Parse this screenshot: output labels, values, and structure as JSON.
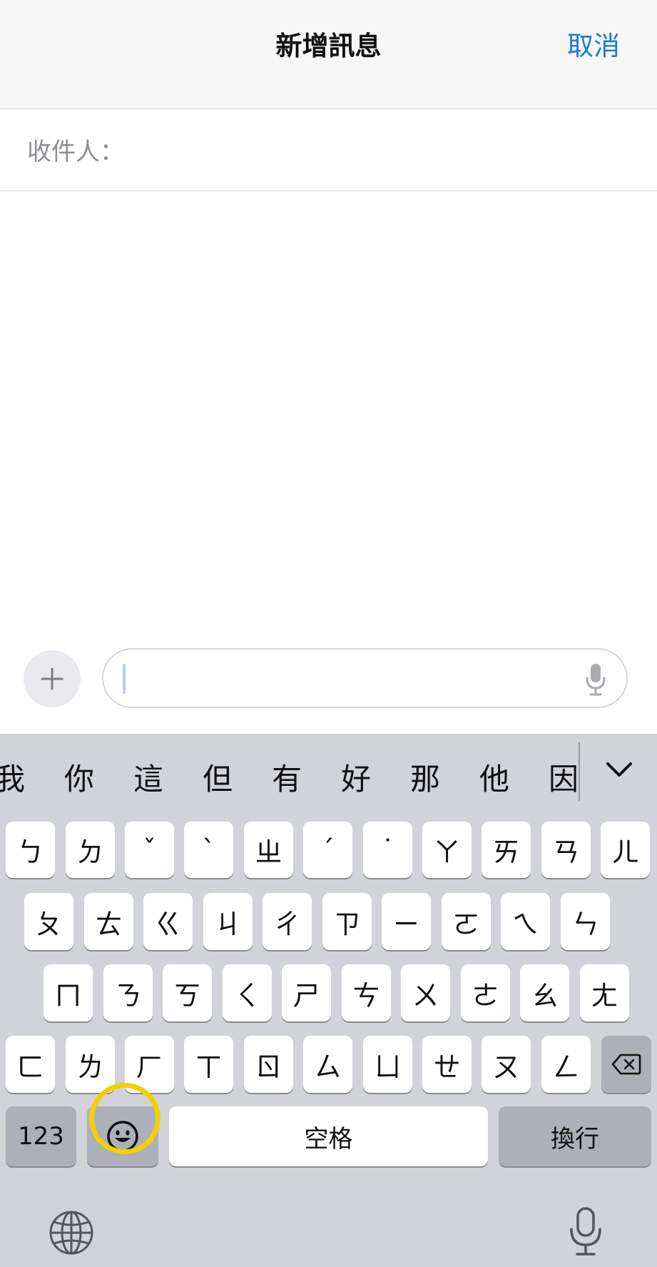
{
  "nav": {
    "title": "新增訊息",
    "cancel": "取消",
    "accent": "#1a7ad8"
  },
  "recipient": {
    "label": "收件人："
  },
  "compose": {
    "add_icon": "plus-icon",
    "mic_icon": "microphone-icon",
    "message_value": ""
  },
  "keyboard": {
    "candidates": [
      "我",
      "你",
      "這",
      "但",
      "有",
      "好",
      "那",
      "他",
      "因"
    ],
    "expand_icon": "chevron-down-icon",
    "row1": [
      "ㄅ",
      "ㄉ",
      "ˇ",
      "ˋ",
      "ㄓ",
      "ˊ",
      "˙",
      "ㄚ",
      "ㄞ",
      "ㄢ",
      "ㄦ"
    ],
    "row2": [
      "ㄆ",
      "ㄊ",
      "ㄍ",
      "ㄐ",
      "ㄔ",
      "ㄗ",
      "ㄧ",
      "ㄛ",
      "ㄟ",
      "ㄣ"
    ],
    "row3": [
      "ㄇ",
      "ㄋ",
      "ㄎ",
      "ㄑ",
      "ㄕ",
      "ㄘ",
      "ㄨ",
      "ㄜ",
      "ㄠ",
      "ㄤ"
    ],
    "row4": [
      "ㄈ",
      "ㄌ",
      "ㄏ",
      "ㄒ",
      "ㄖ",
      "ㄙ",
      "ㄩ",
      "ㄝ",
      "ㄡ",
      "ㄥ"
    ],
    "delete_icon": "backspace-icon",
    "numbers_label": "123",
    "emoji_icon": "emoji-icon",
    "space_label": "空格",
    "return_label": "換行",
    "globe_icon": "globe-icon",
    "dictation_icon": "microphone-icon",
    "highlight_color": "#f5cf00"
  }
}
